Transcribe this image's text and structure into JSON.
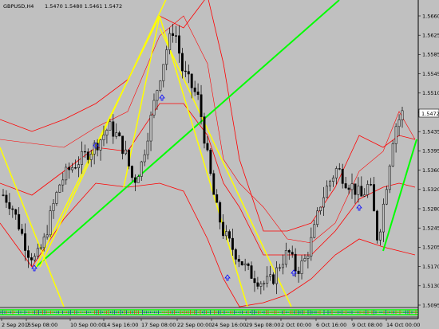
{
  "header": {
    "symbol_tf": "GBPUSD,H4",
    "ohlc": "1.5470 1.5480 1.5461 1.5472"
  },
  "price_box": "1.5472",
  "colors": {
    "background": "#c0c0c0",
    "candle": "#000000",
    "bollinger": "#ff0000",
    "trendline_green": "#00ff00",
    "trendline_yellow": "#ffff00",
    "arrow": "#0000ff",
    "indicator_strip": "#00ff00"
  },
  "chart_data": {
    "type": "line",
    "y_ticks": [
      "1.5660",
      "1.5625",
      "1.5585",
      "1.5545",
      "1.5510",
      "1.5470",
      "1.5435",
      "1.5395",
      "1.5360",
      "1.5320",
      "1.5280",
      "1.5245",
      "1.5205",
      "1.5170",
      "1.5130",
      "1.5095"
    ],
    "x_ticks": [
      "2 Sep 2015",
      "7 Sep 08:00",
      "10 Sep 00:00",
      "14 Sep 16:00",
      "17 Sep 08:00",
      "22 Sep 00:00",
      "24 Sep 16:00",
      "29 Sep 08:00",
      "2 Oct 00:00",
      "6 Oct 16:00",
      "9 Oct 08:00",
      "14 Oct 00:00"
    ],
    "ylim": [
      1.5085,
      1.569
    ],
    "series": [
      {
        "values": [
          1.5305,
          1.5285,
          1.524,
          1.519,
          1.5172,
          1.521,
          1.5275,
          1.533,
          1.5355,
          1.537,
          1.5385,
          1.54,
          1.542,
          1.5445,
          1.5425,
          1.539,
          1.533,
          1.537,
          1.545,
          1.553,
          1.56,
          1.565,
          1.556,
          1.553,
          1.55,
          1.539,
          1.529,
          1.523,
          1.52,
          1.5175,
          1.515,
          1.5135,
          1.5125,
          1.513,
          1.5165,
          1.519,
          1.515,
          1.517,
          1.522,
          1.529,
          1.533,
          1.536,
          1.5335,
          1.532,
          1.53,
          1.533,
          1.521,
          1.532,
          1.544,
          1.5472
        ]
      }
    ]
  }
}
